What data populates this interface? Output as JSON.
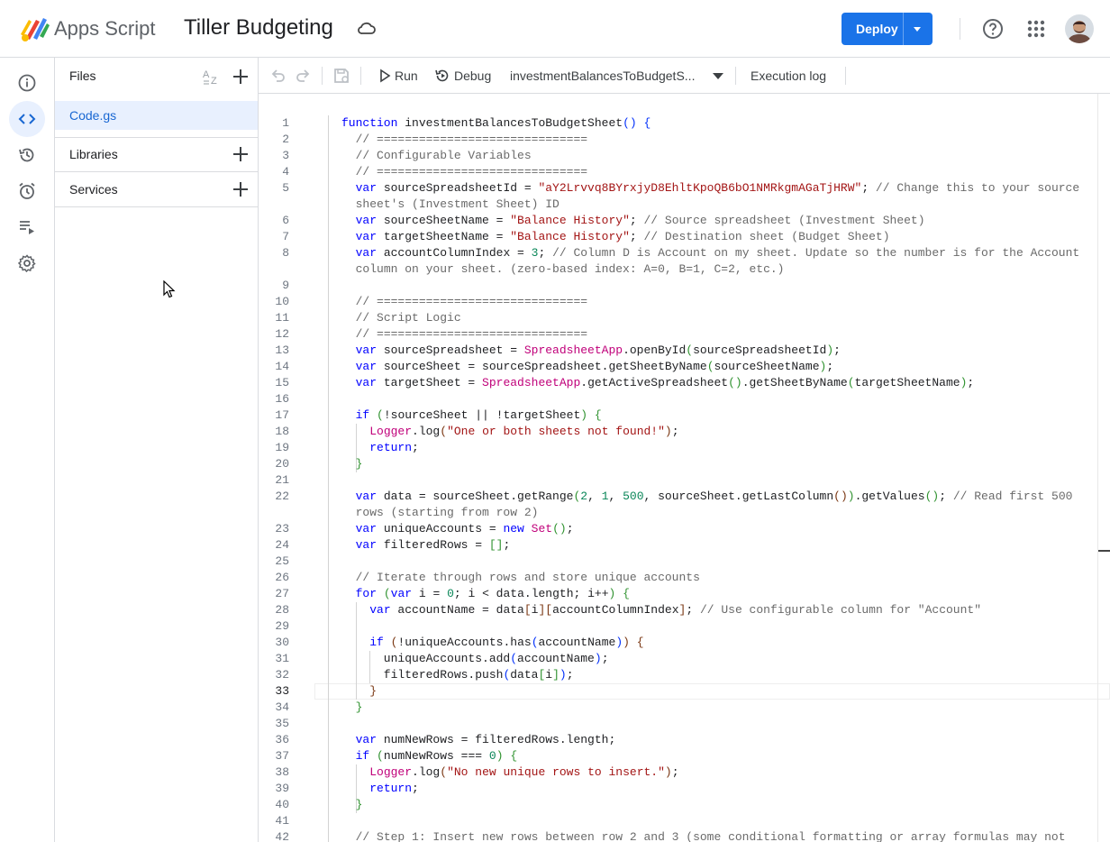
{
  "header": {
    "app_name": "Apps Script",
    "project_title": "Tiller Budgeting",
    "deploy_label": "Deploy"
  },
  "rail": {
    "items": [
      "overview",
      "editor",
      "project-history",
      "triggers",
      "executions",
      "project-settings"
    ],
    "active": "editor"
  },
  "files_panel": {
    "title": "Files",
    "files": [
      "Code.gs"
    ],
    "libraries_label": "Libraries",
    "services_label": "Services"
  },
  "toolbar": {
    "run_label": "Run",
    "debug_label": "Debug",
    "function_select": "investmentBalancesToBudgetS...",
    "execution_log_label": "Execution log"
  },
  "editor": {
    "current_line": 33,
    "lines": [
      {
        "n": "1",
        "html": "<span class=\"kw\">function</span> investmentBalancesToBudgetSheet<span class=\"br1\">()</span> <span class=\"br1\">{</span>"
      },
      {
        "n": "2",
        "html": "  <span class=\"cm\">// ==============================</span>"
      },
      {
        "n": "3",
        "html": "  <span class=\"cm\">// Configurable Variables</span>"
      },
      {
        "n": "4",
        "html": "  <span class=\"cm\">// ==============================</span>"
      },
      {
        "n": "5",
        "html": "  <span class=\"kw\">var</span> sourceSpreadsheetId = <span class=\"str\">\"aY2Lrvvq8BYrxjyD8EhltKpoQB6bO1NMRkgmAGaTjHRW\"</span>; <span class=\"cm\">// Change this to your source</span>"
      },
      {
        "n": "",
        "html": "  <span class=\"cm\">sheet's (Investment Sheet) ID</span>"
      },
      {
        "n": "6",
        "html": "  <span class=\"kw\">var</span> sourceSheetName = <span class=\"str\">\"Balance History\"</span>; <span class=\"cm\">// Source spreadsheet (Investment Sheet)</span>"
      },
      {
        "n": "7",
        "html": "  <span class=\"kw\">var</span> targetSheetName = <span class=\"str\">\"Balance History\"</span>; <span class=\"cm\">// Destination sheet (Budget Sheet)</span>"
      },
      {
        "n": "8",
        "html": "  <span class=\"kw\">var</span> accountColumnIndex = <span class=\"num\">3</span>; <span class=\"cm\">// Column D is Account on my sheet. Update so the number is for the Account</span>"
      },
      {
        "n": "",
        "html": "  <span class=\"cm\">column on your sheet. (zero-based index: A=0, B=1, C=2, etc.)</span>"
      },
      {
        "n": "9",
        "html": ""
      },
      {
        "n": "10",
        "html": "  <span class=\"cm\">// ==============================</span>"
      },
      {
        "n": "11",
        "html": "  <span class=\"cm\">// Script Logic</span>"
      },
      {
        "n": "12",
        "html": "  <span class=\"cm\">// ==============================</span>"
      },
      {
        "n": "13",
        "html": "  <span class=\"kw\">var</span> sourceSpreadsheet = <span class=\"cls\">SpreadsheetApp</span>.openById<span class=\"br2\">(</span>sourceSpreadsheetId<span class=\"br2\">)</span>;"
      },
      {
        "n": "14",
        "html": "  <span class=\"kw\">var</span> sourceSheet = sourceSpreadsheet.getSheetByName<span class=\"br2\">(</span>sourceSheetName<span class=\"br2\">)</span>;"
      },
      {
        "n": "15",
        "html": "  <span class=\"kw\">var</span> targetSheet = <span class=\"cls\">SpreadsheetApp</span>.getActiveSpreadsheet<span class=\"br2\">()</span>.getSheetByName<span class=\"br2\">(</span>targetSheetName<span class=\"br2\">)</span>;"
      },
      {
        "n": "16",
        "html": ""
      },
      {
        "n": "17",
        "html": "  <span class=\"kw\">if</span> <span class=\"br2\">(</span>!sourceSheet || !targetSheet<span class=\"br2\">)</span> <span class=\"br2\">{</span>"
      },
      {
        "n": "18",
        "html": "    <span class=\"cls\">Logger</span>.log<span class=\"br3\">(</span><span class=\"str\">\"One or both sheets not found!\"</span><span class=\"br3\">)</span>;"
      },
      {
        "n": "19",
        "html": "    <span class=\"kw\">return</span>;"
      },
      {
        "n": "20",
        "html": "  <span class=\"br2\">}</span>"
      },
      {
        "n": "21",
        "html": ""
      },
      {
        "n": "22",
        "html": "  <span class=\"kw\">var</span> data = sourceSheet.getRange<span class=\"br2\">(</span><span class=\"num\">2</span>, <span class=\"num\">1</span>, <span class=\"num\">500</span>, sourceSheet.getLastColumn<span class=\"br3\">()</span><span class=\"br2\">)</span>.getValues<span class=\"br2\">()</span>; <span class=\"cm\">// Read first 500</span>"
      },
      {
        "n": "",
        "html": "  <span class=\"cm\">rows (starting from row 2)</span>"
      },
      {
        "n": "23",
        "html": "  <span class=\"kw\">var</span> uniqueAccounts = <span class=\"kw\">new</span> <span class=\"cls\">Set</span><span class=\"br2\">()</span>;"
      },
      {
        "n": "24",
        "html": "  <span class=\"kw\">var</span> filteredRows = <span class=\"br2\">[]</span>;"
      },
      {
        "n": "25",
        "html": ""
      },
      {
        "n": "26",
        "html": "  <span class=\"cm\">// Iterate through rows and store unique accounts</span>"
      },
      {
        "n": "27",
        "html": "  <span class=\"kw\">for</span> <span class=\"br2\">(</span><span class=\"kw\">var</span> i = <span class=\"num\">0</span>; i &lt; data.length; i++<span class=\"br2\">)</span> <span class=\"br2\">{</span>"
      },
      {
        "n": "28",
        "html": "    <span class=\"kw\">var</span> accountName = data<span class=\"br3\">[</span>i<span class=\"br3\">][</span>accountColumnIndex<span class=\"br3\">]</span>; <span class=\"cm\">// Use configurable column for \"Account\"</span>"
      },
      {
        "n": "29",
        "html": ""
      },
      {
        "n": "30",
        "html": "    <span class=\"kw\">if</span> <span class=\"br3\">(</span>!uniqueAccounts.has<span class=\"br1\">(</span>accountName<span class=\"br1\">)</span><span class=\"br3\">)</span> <span class=\"br3\">{</span>"
      },
      {
        "n": "31",
        "html": "      uniqueAccounts.add<span class=\"br1\">(</span>accountName<span class=\"br1\">)</span>;"
      },
      {
        "n": "32",
        "html": "      filteredRows.push<span class=\"br1\">(</span>data<span class=\"br2\">[</span>i<span class=\"br2\">]</span><span class=\"br1\">)</span>;"
      },
      {
        "n": "33",
        "html": "    <span class=\"br3\">}</span>"
      },
      {
        "n": "34",
        "html": "  <span class=\"br2\">}</span>"
      },
      {
        "n": "35",
        "html": ""
      },
      {
        "n": "36",
        "html": "  <span class=\"kw\">var</span> numNewRows = filteredRows.length;"
      },
      {
        "n": "37",
        "html": "  <span class=\"kw\">if</span> <span class=\"br2\">(</span>numNewRows === <span class=\"num\">0</span><span class=\"br2\">)</span> <span class=\"br2\">{</span>"
      },
      {
        "n": "38",
        "html": "    <span class=\"cls\">Logger</span>.log<span class=\"br3\">(</span><span class=\"str\">\"No new unique rows to insert.\"</span><span class=\"br3\">)</span>;"
      },
      {
        "n": "39",
        "html": "    <span class=\"kw\">return</span>;"
      },
      {
        "n": "40",
        "html": "  <span class=\"br2\">}</span>"
      },
      {
        "n": "41",
        "html": ""
      },
      {
        "n": "42",
        "html": "  <span class=\"cm\">// Step 1: Insert new rows between row 2 and 3 (some conditional formatting or array formulas may not</span>"
      }
    ]
  },
  "colors": {
    "accent": "#1a73e8",
    "selected_bg": "#e8f0fe",
    "selected_text": "#1967d2",
    "keyword": "#0000ff",
    "string": "#a31515",
    "comment": "#6a6a6a",
    "number": "#098658"
  }
}
